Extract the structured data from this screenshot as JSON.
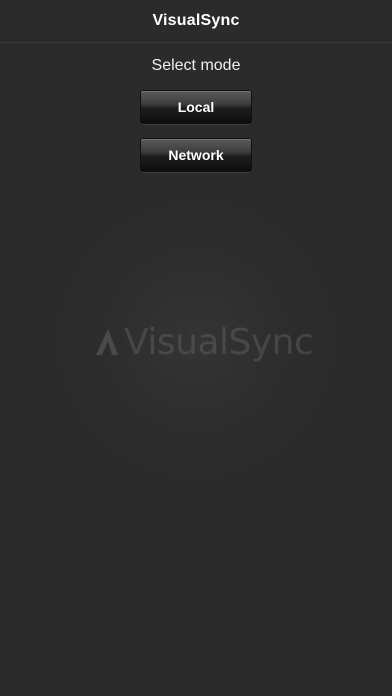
{
  "navbar": {
    "title": "VisualSync"
  },
  "main": {
    "subtitle": "Select mode",
    "buttons": {
      "local": "Local",
      "network": "Network"
    }
  },
  "background": {
    "watermark_text": "VisualSync",
    "watermark_icon": "triangle-logo-icon"
  },
  "colors": {
    "background": "#2b2b2b",
    "text": "#ffffff"
  }
}
